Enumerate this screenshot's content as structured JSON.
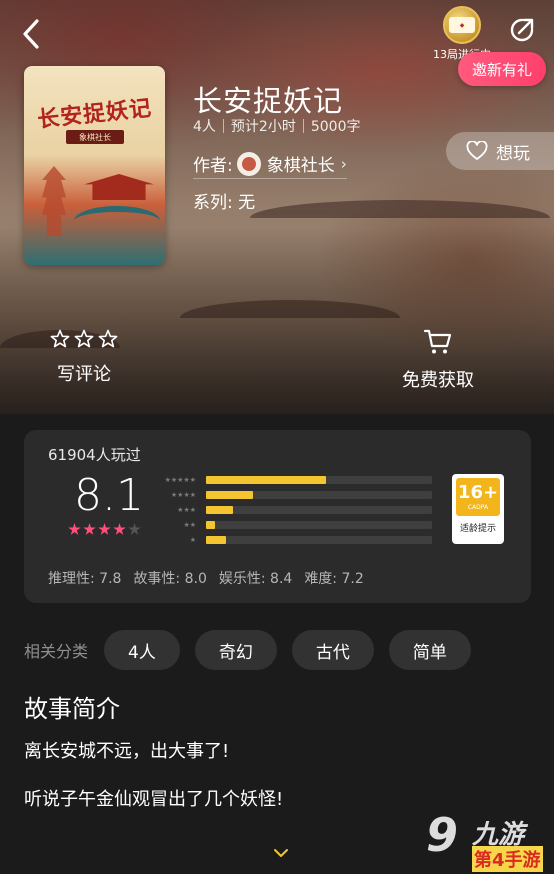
{
  "header": {
    "progress_text": "13局进行中",
    "invite_label": "邀新有礼"
  },
  "game": {
    "title": "长安捉妖记",
    "cover_title": "长安捉妖记",
    "cover_subtitle": "象棋社长",
    "players": "4人",
    "duration": "预计2小时",
    "words": "5000字",
    "author_label": "作者:",
    "author_name": "象棋社长",
    "series_label": "系列: 无",
    "want_label": "想玩"
  },
  "actions": {
    "review_label": "写评论",
    "get_label": "免费获取"
  },
  "rating": {
    "played_text": "61904人玩过",
    "score": "8.1",
    "score_stars": 4,
    "distribution": [
      {
        "stars": "★★★★★",
        "fraction": 0.53
      },
      {
        "stars": "★★★★",
        "fraction": 0.21
      },
      {
        "stars": "★★★",
        "fraction": 0.12
      },
      {
        "stars": "★★",
        "fraction": 0.04
      },
      {
        "stars": "★",
        "fraction": 0.09
      }
    ],
    "age_rating": "16+",
    "age_org": "CADPA",
    "age_tip": "适龄提示",
    "dimensions": [
      "推理性: 7.8",
      "故事性: 8.0",
      "娱乐性: 8.4",
      "难度: 7.2"
    ]
  },
  "tags": {
    "label": "相关分类",
    "items": [
      "4人",
      "奇幻",
      "古代",
      "简单"
    ]
  },
  "intro": {
    "title": "故事简介",
    "lines": [
      "离长安城不远，出大事了!",
      "听说子午金仙观冒出了几个妖怪!"
    ]
  },
  "watermark": {
    "text": "九游",
    "site": "第4手游"
  },
  "colors": {
    "accent_yellow": "#f5c531",
    "star_pink": "#ff4f7a",
    "invite_pink": "#ff4a74",
    "card_bg": "#2b2b2b"
  }
}
